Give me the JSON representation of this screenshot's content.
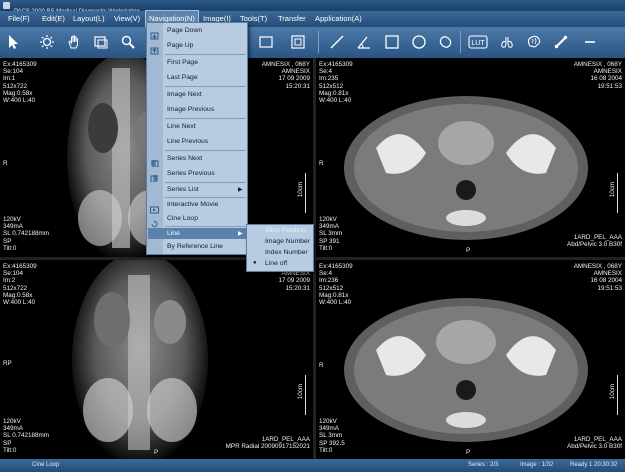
{
  "window": {
    "title": "PACS 2000 BS Medical Diagnostic Workstation"
  },
  "menubar": [
    {
      "label": "File(F)"
    },
    {
      "label": "Edit(E)"
    },
    {
      "label": "Layout(L)"
    },
    {
      "label": "View(V)"
    },
    {
      "label": "Navigation(N)"
    },
    {
      "label": "Image(I)"
    },
    {
      "label": "Tools(T)"
    },
    {
      "label": "Transfer"
    },
    {
      "label": "Application(A)"
    }
  ],
  "toolbar": {
    "buttons": [
      "select-arrow",
      "brightness",
      "pan-hand",
      "zoom-window",
      "magnifier",
      "rectangle-region",
      "rectangle-alt",
      "line-measure",
      "angle-measure",
      "rectangle-roi",
      "ellipse-roi",
      "freehand-roi",
      "lut",
      "lungs",
      "brain",
      "bone",
      "minus"
    ],
    "lut_label": "LUT"
  },
  "navigation_menu": {
    "items": [
      {
        "label": "Page Down"
      },
      {
        "label": "Page Up"
      },
      {
        "label": "First Page"
      },
      {
        "label": "Last Page"
      },
      {
        "label": "Image Next"
      },
      {
        "label": "Image Previous"
      },
      {
        "label": "Line Next"
      },
      {
        "label": "Line Previous"
      },
      {
        "label": "Series Next"
      },
      {
        "label": "Series Previous"
      },
      {
        "label": "Series List"
      },
      {
        "label": "Interactive Movie"
      },
      {
        "label": "Cine Loop"
      },
      {
        "label": "Line"
      },
      {
        "label": "By Reference Line"
      }
    ]
  },
  "line_submenu": {
    "items": [
      {
        "label": "Slice Position",
        "disabled": true
      },
      {
        "label": "Image Number",
        "disabled": false
      },
      {
        "label": "Index Number",
        "disabled": false
      },
      {
        "label": "Line off",
        "disabled": false,
        "checked": true
      }
    ]
  },
  "viewports": [
    {
      "top_left": "Ex:4165309\nSe:104\nIm:1\n512x722\nMag:0.58x\nW:400 L:40",
      "top_right": "AMNESIX , 068Y\nAMNESIX\n17 09 2009\n15:20:31",
      "bottom_left": "120kV\n349mA\nSL 0.742188mm\nSP\nTilt:0",
      "bottom_right": "",
      "side_label": "R",
      "bottom_mark": "P",
      "ruler_label": "10cm"
    },
    {
      "top_left": "Ex:4165309\nSe:4\nIm:235\n512x512\nMag:0.81x\nW:400 L:40",
      "top_right": "AMNESIX , 068Y\nAMNESIX\n16 08 2004\n19:51:53",
      "bottom_left": "120kV\n349mA\nSL 3mm\nSP 391\nTilt:0",
      "bottom_right": "1ARD_PEL_AAA\nAbd/Pelvic 3.0 B30f",
      "side_label": "R",
      "bottom_mark": "P",
      "ruler_label": "10cm"
    },
    {
      "top_left": "Ex:4165309\nSe:104\nIm:2\n512x722\nMag:0.58x\nW:400 L:40",
      "top_right": "AMNESIX , 068Y\nAMNESIX\n17 09 2009\n15:20:31",
      "bottom_left": "120kV\n349mA\nSL 0.742188mm\nSP\nTilt:0",
      "bottom_right": "1ARD_PEL_AAA\nMPR Radial 20090917152021",
      "side_label": "RP",
      "bottom_mark": "P",
      "ruler_label": "10cm"
    },
    {
      "top_left": "Ex:4165309\nSe:4\nIm:236\n512x512\nMag:0.81x\nW:400 L:40",
      "top_right": "AMNESIX , 068Y\nAMNESIX\n16 08 2004\n19:51:53",
      "bottom_left": "120kV\n349mA\nSL 3mm\nSP 392.5\nTilt:0",
      "bottom_right": "1ARD_PEL_AAA\nAbd/Pelvic 3.0 B30f",
      "side_label": "R",
      "bottom_mark": "P",
      "ruler_label": "10cm"
    }
  ],
  "statusbar": {
    "mode": "Cine Loop",
    "series": "Series : 2/3",
    "image": "Image : 1/32",
    "ready": "Ready  1  20:30:32"
  },
  "colors": {
    "menu_bar": "#2d5a88",
    "menu_popup": "#b9cbe0",
    "highlight": "#5b80aa"
  }
}
